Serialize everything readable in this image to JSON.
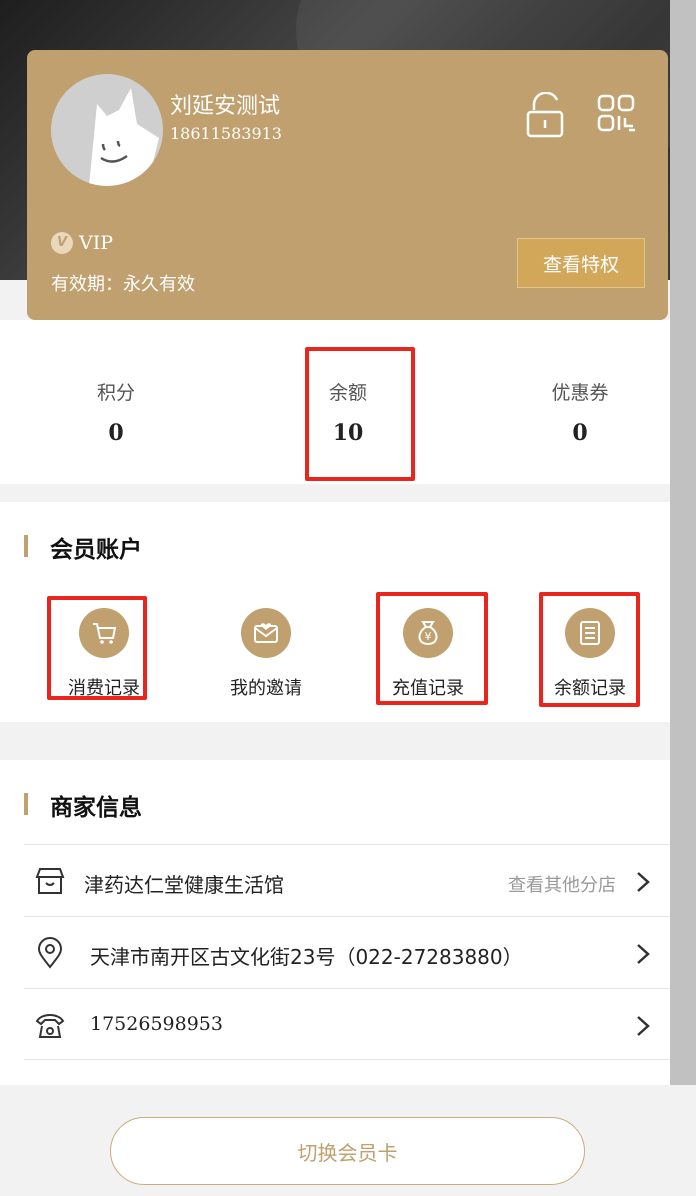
{
  "profile": {
    "name": "刘延安测试",
    "phone": "18611583913",
    "vip_badge": "V",
    "vip_level": "VIP",
    "validity": "有效期：永久有效",
    "privilege_button": "查看特权"
  },
  "stats": [
    {
      "label": "积分",
      "value": "0"
    },
    {
      "label": "余额",
      "value": "10"
    },
    {
      "label": "优惠券",
      "value": "0"
    }
  ],
  "member_account": {
    "title": "会员账户",
    "items": [
      {
        "label": "消费记录",
        "icon": "cart-icon"
      },
      {
        "label": "我的邀请",
        "icon": "envelope-heart-icon"
      },
      {
        "label": "充值记录",
        "icon": "money-bag-icon"
      },
      {
        "label": "余额记录",
        "icon": "ledger-icon"
      }
    ]
  },
  "merchant": {
    "title": "商家信息",
    "store_name": "津药达仁堂健康生活馆",
    "other_stores": "查看其他分店",
    "address": "天津市南开区古文化街23号（022-27283880）",
    "phone": "17526598953"
  },
  "switch_button": "切换会员卡",
  "colors": {
    "gold": "#c0a06e",
    "highlight": "#e8261e"
  }
}
